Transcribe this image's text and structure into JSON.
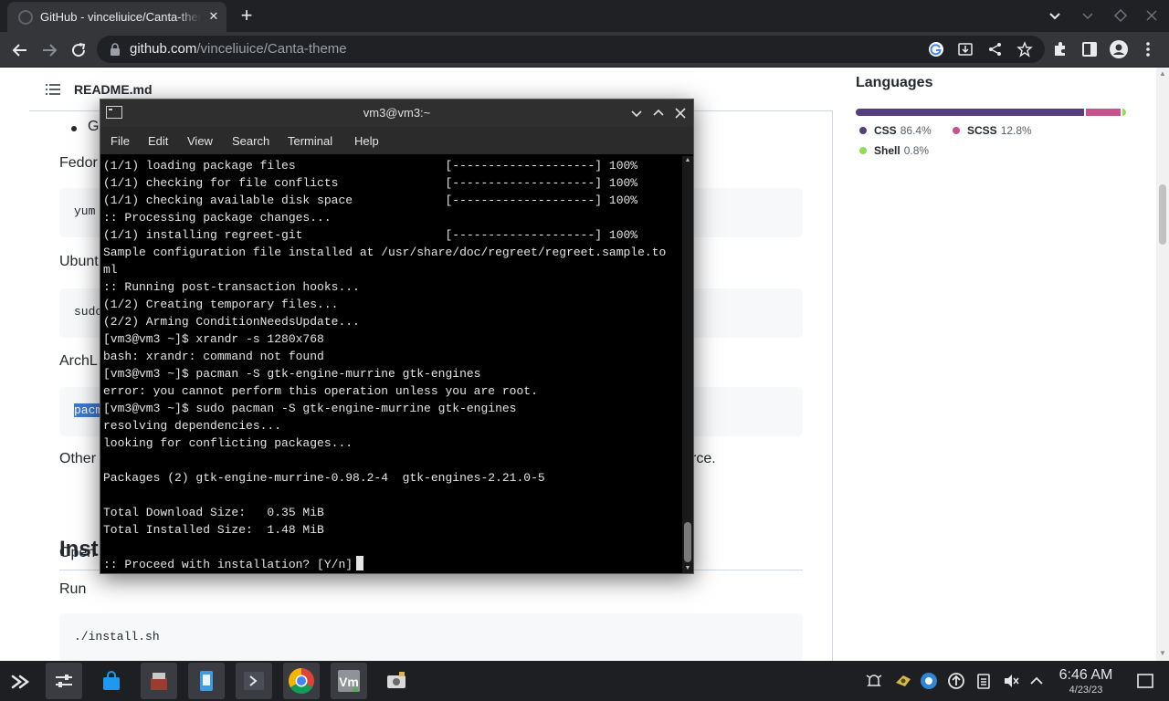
{
  "browser": {
    "tab_title": "GitHub - vinceliuice/Canta-theme",
    "url_host": "github.com",
    "url_path": "/vinceliuice/Canta-theme"
  },
  "readme": {
    "header_title": "README.md",
    "bullet_text": "G",
    "fedora_label": "Fedor",
    "fedora_code": "yum",
    "ubuntu_label": "Ubunt",
    "ubuntu_code": "sudo",
    "arch_label": "ArchL",
    "arch_code": "pacm",
    "other_label": "Other",
    "other_suffix": "rce.",
    "install_heading": "Inst",
    "open_label": "Open",
    "run_label": "Run",
    "run_code": "./install.sh"
  },
  "languages": {
    "title": "Languages",
    "items": [
      {
        "name": "CSS",
        "percent": "86.4%",
        "color": "#563d7c"
      },
      {
        "name": "SCSS",
        "percent": "12.8%",
        "color": "#c6538c"
      },
      {
        "name": "Shell",
        "percent": "0.8%",
        "color": "#89e051"
      }
    ]
  },
  "terminal": {
    "title": "vm3@vm3:~",
    "menu": [
      "File",
      "Edit",
      "View",
      "Search",
      "Terminal",
      "Help"
    ],
    "lines": [
      "(1/1) loading package files                     [--------------------] 100%",
      "(1/1) checking for file conflicts               [--------------------] 100%",
      "(1/1) checking available disk space             [--------------------] 100%",
      ":: Processing package changes...",
      "(1/1) installing regreet-git                    [--------------------] 100%",
      "Sample configuration file installed at /usr/share/doc/regreet/regreet.sample.to",
      "ml",
      ":: Running post-transaction hooks...",
      "(1/2) Creating temporary files...",
      "(2/2) Arming ConditionNeedsUpdate...",
      "[vm3@vm3 ~]$ xrandr -s 1280x768",
      "bash: xrandr: command not found",
      "[vm3@vm3 ~]$ pacman -S gtk-engine-murrine gtk-engines",
      "error: you cannot perform this operation unless you are root.",
      "[vm3@vm3 ~]$ sudo pacman -S gtk-engine-murrine gtk-engines",
      "resolving dependencies...",
      "looking for conflicting packages...",
      "",
      "Packages (2) gtk-engine-murrine-0.98.2-4  gtk-engines-2.21.0-5",
      "",
      "Total Download Size:   0.35 MiB",
      "Total Installed Size:  1.48 MiB",
      ""
    ],
    "prompt_line": ":: Proceed with installation? [Y/n]"
  },
  "taskbar": {
    "time": "6:46 AM",
    "date": "4/23/23",
    "vm_label": "Vm"
  }
}
